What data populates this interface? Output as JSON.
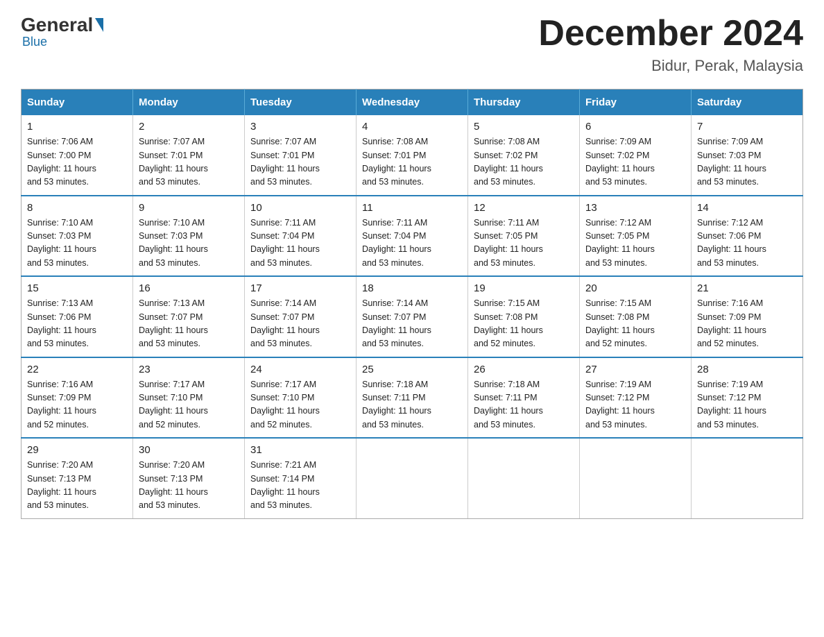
{
  "header": {
    "logo": {
      "general": "General",
      "blue": "Blue"
    },
    "title": "December 2024",
    "location": "Bidur, Perak, Malaysia"
  },
  "weekdays": [
    "Sunday",
    "Monday",
    "Tuesday",
    "Wednesday",
    "Thursday",
    "Friday",
    "Saturday"
  ],
  "weeks": [
    [
      {
        "day": "1",
        "sunrise": "7:06 AM",
        "sunset": "7:00 PM",
        "daylight": "11 hours and 53 minutes."
      },
      {
        "day": "2",
        "sunrise": "7:07 AM",
        "sunset": "7:01 PM",
        "daylight": "11 hours and 53 minutes."
      },
      {
        "day": "3",
        "sunrise": "7:07 AM",
        "sunset": "7:01 PM",
        "daylight": "11 hours and 53 minutes."
      },
      {
        "day": "4",
        "sunrise": "7:08 AM",
        "sunset": "7:01 PM",
        "daylight": "11 hours and 53 minutes."
      },
      {
        "day": "5",
        "sunrise": "7:08 AM",
        "sunset": "7:02 PM",
        "daylight": "11 hours and 53 minutes."
      },
      {
        "day": "6",
        "sunrise": "7:09 AM",
        "sunset": "7:02 PM",
        "daylight": "11 hours and 53 minutes."
      },
      {
        "day": "7",
        "sunrise": "7:09 AM",
        "sunset": "7:03 PM",
        "daylight": "11 hours and 53 minutes."
      }
    ],
    [
      {
        "day": "8",
        "sunrise": "7:10 AM",
        "sunset": "7:03 PM",
        "daylight": "11 hours and 53 minutes."
      },
      {
        "day": "9",
        "sunrise": "7:10 AM",
        "sunset": "7:03 PM",
        "daylight": "11 hours and 53 minutes."
      },
      {
        "day": "10",
        "sunrise": "7:11 AM",
        "sunset": "7:04 PM",
        "daylight": "11 hours and 53 minutes."
      },
      {
        "day": "11",
        "sunrise": "7:11 AM",
        "sunset": "7:04 PM",
        "daylight": "11 hours and 53 minutes."
      },
      {
        "day": "12",
        "sunrise": "7:11 AM",
        "sunset": "7:05 PM",
        "daylight": "11 hours and 53 minutes."
      },
      {
        "day": "13",
        "sunrise": "7:12 AM",
        "sunset": "7:05 PM",
        "daylight": "11 hours and 53 minutes."
      },
      {
        "day": "14",
        "sunrise": "7:12 AM",
        "sunset": "7:06 PM",
        "daylight": "11 hours and 53 minutes."
      }
    ],
    [
      {
        "day": "15",
        "sunrise": "7:13 AM",
        "sunset": "7:06 PM",
        "daylight": "11 hours and 53 minutes."
      },
      {
        "day": "16",
        "sunrise": "7:13 AM",
        "sunset": "7:07 PM",
        "daylight": "11 hours and 53 minutes."
      },
      {
        "day": "17",
        "sunrise": "7:14 AM",
        "sunset": "7:07 PM",
        "daylight": "11 hours and 53 minutes."
      },
      {
        "day": "18",
        "sunrise": "7:14 AM",
        "sunset": "7:07 PM",
        "daylight": "11 hours and 53 minutes."
      },
      {
        "day": "19",
        "sunrise": "7:15 AM",
        "sunset": "7:08 PM",
        "daylight": "11 hours and 52 minutes."
      },
      {
        "day": "20",
        "sunrise": "7:15 AM",
        "sunset": "7:08 PM",
        "daylight": "11 hours and 52 minutes."
      },
      {
        "day": "21",
        "sunrise": "7:16 AM",
        "sunset": "7:09 PM",
        "daylight": "11 hours and 52 minutes."
      }
    ],
    [
      {
        "day": "22",
        "sunrise": "7:16 AM",
        "sunset": "7:09 PM",
        "daylight": "11 hours and 52 minutes."
      },
      {
        "day": "23",
        "sunrise": "7:17 AM",
        "sunset": "7:10 PM",
        "daylight": "11 hours and 52 minutes."
      },
      {
        "day": "24",
        "sunrise": "7:17 AM",
        "sunset": "7:10 PM",
        "daylight": "11 hours and 52 minutes."
      },
      {
        "day": "25",
        "sunrise": "7:18 AM",
        "sunset": "7:11 PM",
        "daylight": "11 hours and 53 minutes."
      },
      {
        "day": "26",
        "sunrise": "7:18 AM",
        "sunset": "7:11 PM",
        "daylight": "11 hours and 53 minutes."
      },
      {
        "day": "27",
        "sunrise": "7:19 AM",
        "sunset": "7:12 PM",
        "daylight": "11 hours and 53 minutes."
      },
      {
        "day": "28",
        "sunrise": "7:19 AM",
        "sunset": "7:12 PM",
        "daylight": "11 hours and 53 minutes."
      }
    ],
    [
      {
        "day": "29",
        "sunrise": "7:20 AM",
        "sunset": "7:13 PM",
        "daylight": "11 hours and 53 minutes."
      },
      {
        "day": "30",
        "sunrise": "7:20 AM",
        "sunset": "7:13 PM",
        "daylight": "11 hours and 53 minutes."
      },
      {
        "day": "31",
        "sunrise": "7:21 AM",
        "sunset": "7:14 PM",
        "daylight": "11 hours and 53 minutes."
      },
      null,
      null,
      null,
      null
    ]
  ],
  "labels": {
    "sunrise": "Sunrise:",
    "sunset": "Sunset:",
    "daylight": "Daylight:"
  }
}
